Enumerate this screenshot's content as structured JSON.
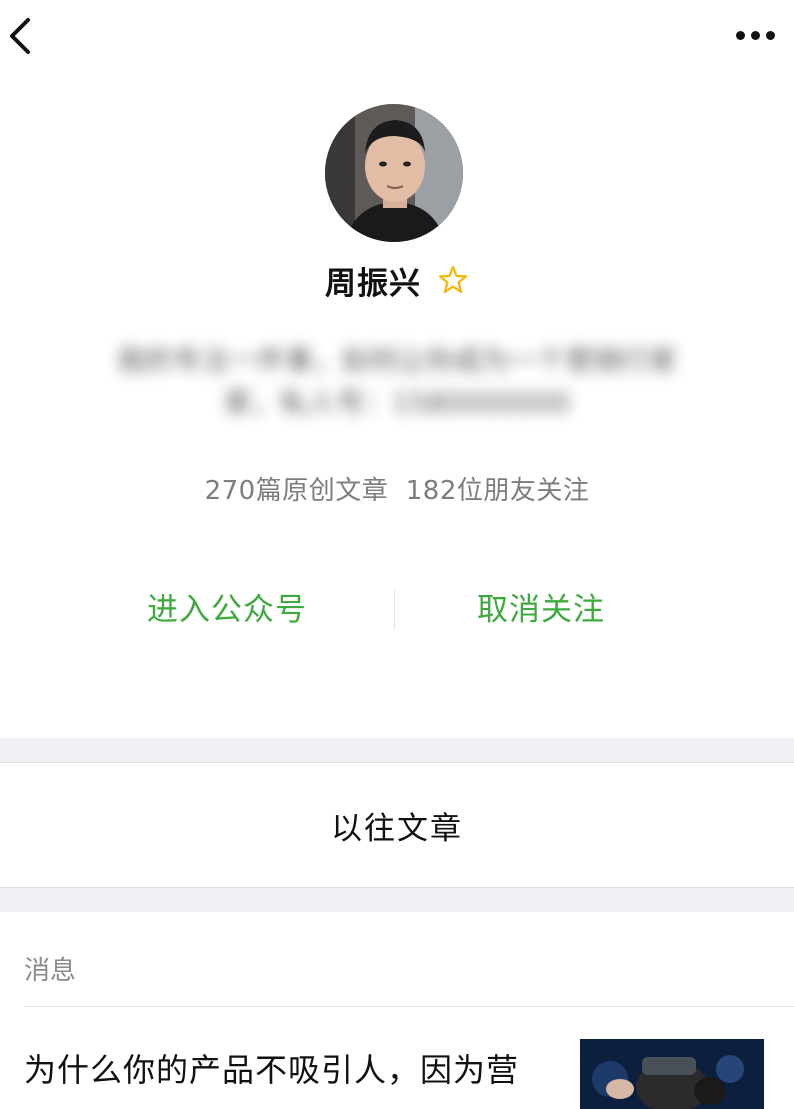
{
  "profile": {
    "name": "周振兴",
    "bio_line1": "我的专注一件事，如何让你成为一个营销行家",
    "bio_line2": "家，私人号：1580000000",
    "stats": "270篇原创文章  182位朋友关注",
    "starred": true
  },
  "actions": {
    "enter": "进入公众号",
    "unfollow": "取消关注"
  },
  "past_articles": "以往文章",
  "messages": {
    "header": "消息",
    "items": [
      {
        "title": "为什么你的产品不吸引人，因为营"
      }
    ]
  },
  "icons": {
    "back": "back-arrow-icon",
    "more": "more-dots-icon",
    "star": "star-outline-icon"
  },
  "colors": {
    "accent_green": "#3eaa3e",
    "star_yellow": "#f5b800",
    "section_gap": "#efeff4",
    "muted_text": "#7d7d7d"
  }
}
